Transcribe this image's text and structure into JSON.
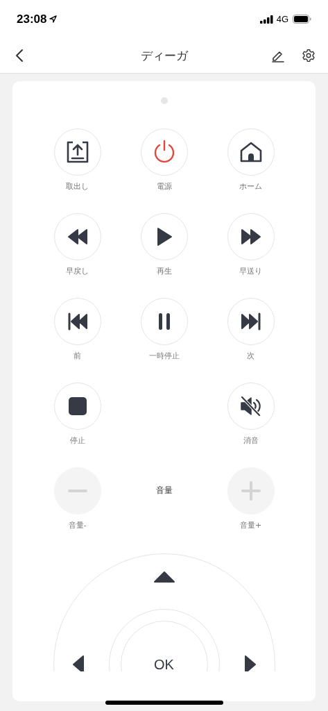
{
  "status_bar": {
    "time": "23:08",
    "network": "4G"
  },
  "nav_bar": {
    "title": "ディーガ"
  },
  "remote": {
    "rows": [
      {
        "left": {
          "label": "取出し",
          "kind": "eject",
          "disabled": false
        },
        "center": {
          "label": "電源",
          "kind": "power",
          "disabled": false
        },
        "right": {
          "label": "ホーム",
          "kind": "home",
          "disabled": false
        }
      },
      {
        "left": {
          "label": "早戻し",
          "kind": "rewind",
          "disabled": false
        },
        "center": {
          "label": "再生",
          "kind": "play",
          "disabled": false
        },
        "right": {
          "label": "早送り",
          "kind": "forward",
          "disabled": false
        }
      },
      {
        "left": {
          "label": "前",
          "kind": "previous",
          "disabled": false
        },
        "center": {
          "label": "一時停止",
          "kind": "pause",
          "disabled": false
        },
        "right": {
          "label": "次",
          "kind": "next",
          "disabled": false
        }
      },
      {
        "left": {
          "label": "停止",
          "kind": "stop",
          "disabled": false
        },
        "right": {
          "label": "消音",
          "kind": "mute",
          "disabled": false
        }
      },
      {
        "left": {
          "label": "音量-",
          "kind": "minus",
          "disabled": true
        },
        "center": {
          "text": "音量",
          "kind": "caption"
        },
        "right": {
          "label": "音量+",
          "kind": "plus",
          "disabled": true
        }
      }
    ],
    "dpad": {
      "ok_label": "OK"
    }
  }
}
